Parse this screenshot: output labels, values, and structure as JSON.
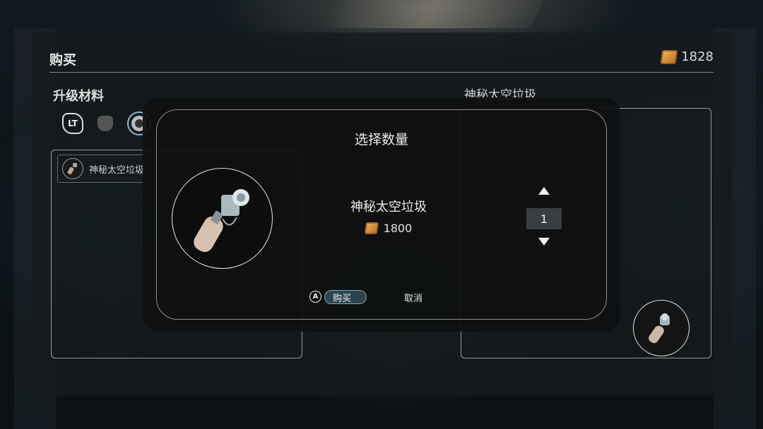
{
  "header": {
    "title": "购买",
    "currency_amount": "1828",
    "currency_icon": "coin-icon"
  },
  "left_panel": {
    "section_label": "升级材料",
    "tab_badge": "LT",
    "list_items": [
      {
        "label": "神秘太空垃圾"
      }
    ]
  },
  "right_panel": {
    "title": "神秘太空垃圾"
  },
  "dialog": {
    "title": "选择数量",
    "item_name": "神秘太空垃圾",
    "price": "1800",
    "quantity": "1",
    "a_badge": "A",
    "buy_label": "购买",
    "cancel_label": "取消"
  },
  "colors": {
    "accent": "#7aa0b0",
    "coin": "#e0a04a"
  }
}
